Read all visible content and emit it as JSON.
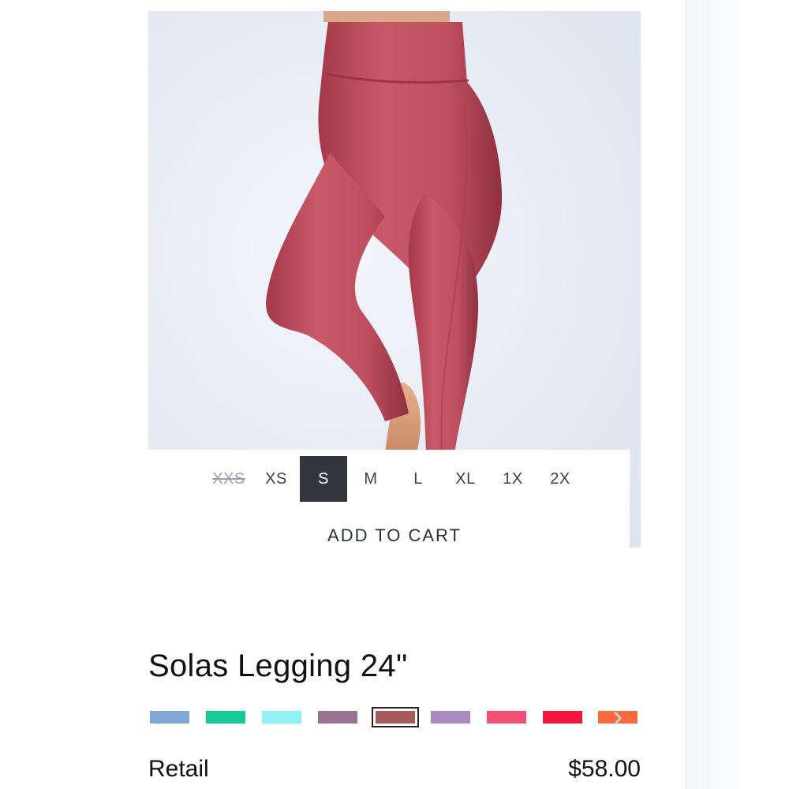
{
  "product": {
    "image_alt": "Solas Legging 24\" in rose",
    "title": "Solas Legging 24\""
  },
  "sizes": [
    {
      "label": "XXS",
      "state": "unavailable"
    },
    {
      "label": "XS",
      "state": "available"
    },
    {
      "label": "S",
      "state": "selected"
    },
    {
      "label": "M",
      "state": "available"
    },
    {
      "label": "L",
      "state": "available"
    },
    {
      "label": "XL",
      "state": "available"
    },
    {
      "label": "1X",
      "state": "available"
    },
    {
      "label": "2X",
      "state": "available"
    }
  ],
  "cart": {
    "add_label": "ADD TO CART"
  },
  "swatches": {
    "prev_icon": "chevron-left-icon",
    "next_icon": "chevron-right-icon",
    "colors": [
      {
        "hex": "#7fa8d6",
        "selected": false
      },
      {
        "hex": "#17c994",
        "selected": false
      },
      {
        "hex": "#8ff0f5",
        "selected": false
      },
      {
        "hex": "#9c7290",
        "selected": false
      },
      {
        "hex": "#a65a5a",
        "selected": true
      },
      {
        "hex": "#a88cc0",
        "selected": false
      },
      {
        "hex": "#f24f76",
        "selected": false
      },
      {
        "hex": "#f5143a",
        "selected": false
      },
      {
        "hex": "#ff6a3c",
        "selected": false
      }
    ]
  },
  "pricing": {
    "label": "Retail",
    "value": "$58.00"
  },
  "colors": {
    "legging": "#c04f5f",
    "selected_size_bg": "#33373d"
  }
}
